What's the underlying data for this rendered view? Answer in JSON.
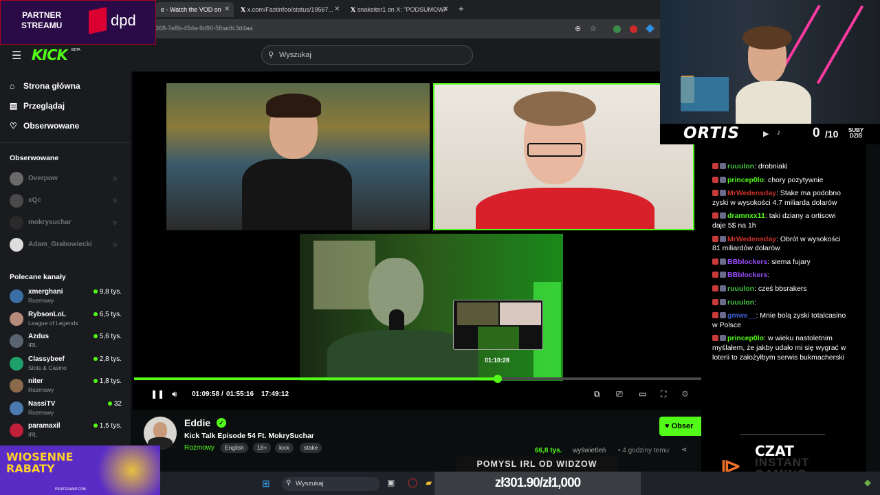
{
  "browser": {
    "tabs": [
      {
        "title": "e - Watch the VOD on",
        "active": true
      },
      {
        "title": "x.com/Fastinfoo/status/19567...",
        "active": false
      },
      {
        "title": "snakeiter1 on X: \"PODSUMOWA...",
        "active": false
      }
    ],
    "url": "368-7e8b-45da-9d90-5fbadfc3d4aa"
  },
  "header": {
    "logo": "KICK",
    "logo_badge": "BETA",
    "search_placeholder": "Wyszukaj"
  },
  "sidebar": {
    "nav": [
      {
        "label": "Strona główna",
        "icon": "home-icon"
      },
      {
        "label": "Przeglądaj",
        "icon": "browse-icon"
      },
      {
        "label": "Obserwowane",
        "icon": "heart-icon"
      }
    ],
    "followed_heading": "Obserwowane",
    "followed": [
      {
        "name": "Overpow"
      },
      {
        "name": "xQc"
      },
      {
        "name": "mokrysuchar"
      },
      {
        "name": "Adam_Grabowiecki"
      }
    ],
    "recommended_heading": "Polecane kanały",
    "recommended": [
      {
        "name": "xmerghani",
        "category": "Rozmowy",
        "viewers": "9,8 tys.",
        "color": "#3a6ea5"
      },
      {
        "name": "RybsonLoL",
        "category": "League of Legends",
        "viewers": "6,5 tys.",
        "color": "#b58a7a"
      },
      {
        "name": "Azdus",
        "category": "IRL",
        "viewers": "5,6 tys.",
        "color": "#5a6470"
      },
      {
        "name": "Classybeef",
        "category": "Slots & Casino",
        "viewers": "2,8 tys.",
        "color": "#1fa06a"
      },
      {
        "name": "niter",
        "category": "Rozmowy",
        "viewers": "1,8 tys.",
        "color": "#8a6a4a"
      },
      {
        "name": "NassiTV",
        "category": "Rozmowy",
        "viewers": "32",
        "color": "#4a7ab0"
      },
      {
        "name": "paramaxil",
        "category": "IRL",
        "viewers": "1,5 tys.",
        "color": "#c0203a"
      }
    ]
  },
  "player": {
    "current_time": "01:09:58",
    "duration": "01:55:16",
    "clock": "17:49:12",
    "hover_time": "01:10:28",
    "progress": 0.641
  },
  "stream": {
    "streamer": "Eddie",
    "title": "Kick Talk Episode 54 Ft. MokrySuchar",
    "category": "Rozmowy",
    "tags": [
      "English",
      "18+",
      "kick",
      "stake"
    ],
    "follow_label": "Obser",
    "viewers": "66,8 tys.",
    "viewers_label": "wyświetleń",
    "ago": "• 4 godziny temu"
  },
  "overlay": {
    "streamer_name": "ORTIS",
    "subs_current": "0",
    "subs_max": "/10",
    "subs_label_1": "SUBY",
    "subs_label_2": "DZIŚ",
    "partner_line1": "PARTNER",
    "partner_line2": "STREAMU",
    "sponsor_brand": "dpd",
    "promo_line1": "WIOSENNE",
    "promo_line2": "RABATY",
    "promo_url": "PIRATESWAP.COM",
    "idea_banner": "POMYSL IRL OD WIDZOW",
    "money": "zł301.90/zł1,000",
    "chat_title": "CZAT",
    "chat_sponsor_1": "INSTANT",
    "chat_sponsor_2": "GAMING",
    "taskbar_search": "Wyszukaj"
  },
  "chat": [
    {
      "user": "ruuulon",
      "color": "#3fbf3f",
      "text": "drobniaki"
    },
    {
      "user": "princep0lo",
      "color": "#53fc18",
      "text": "chory pozytywnie"
    },
    {
      "user": "MrWedensday",
      "color": "#c8322a",
      "text": "Stake ma podobno zyski w wysokości 4.7 miliarda dolarów"
    },
    {
      "user": "dramnxx11",
      "color": "#53fc18",
      "text": "taki dziany a ortisowi daje 5$ na 1h"
    },
    {
      "user": "MrWedensday",
      "color": "#c8322a",
      "text": "Obrót w wysokości 81 miliardów dolarów"
    },
    {
      "user": "BBblockers",
      "color": "#9b4dff",
      "text": "siema fujary"
    },
    {
      "user": "BBblockers",
      "color": "#9b4dff",
      "text": ""
    },
    {
      "user": "ruuulon",
      "color": "#3fbf3f",
      "text": "cześ bbsrakers"
    },
    {
      "user": "ruuulon",
      "color": "#3fbf3f",
      "text": ""
    },
    {
      "user": "gmwe__",
      "color": "#3a5fd0",
      "text": "Mnie bolą zyski totalcasino w Polsce"
    },
    {
      "user": "princep0lo",
      "color": "#53fc18",
      "text": "w wieku nastoletnim myślałem, że jakby udało mi się wygrać w loterii to założyłbym serwis bukmacherski"
    }
  ]
}
